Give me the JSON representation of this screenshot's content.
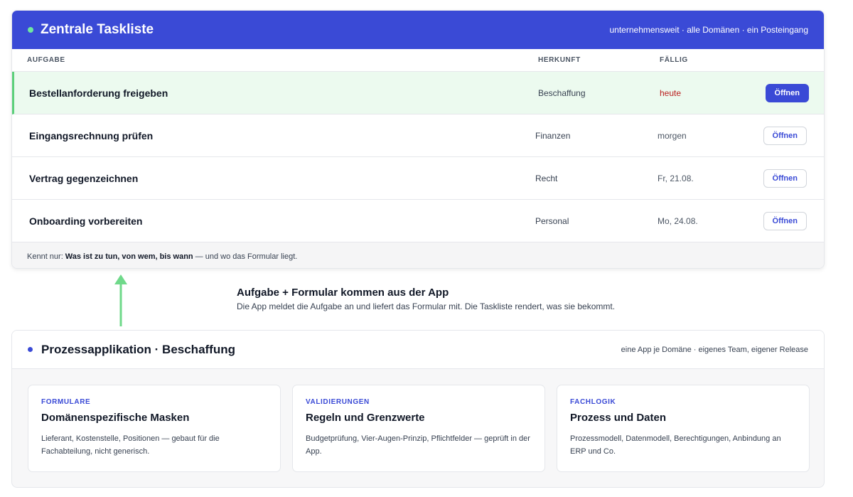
{
  "tasklist": {
    "title": "Zentrale Taskliste",
    "scope": "unternehmensweit · alle Domänen · ein Posteingang",
    "columns": {
      "task": "AUFGABE",
      "origin": "HERKUNFT",
      "due": "FÄLLIG"
    },
    "rows": [
      {
        "name": "Bestellanforderung freigeben",
        "origin": "Beschaffung",
        "due": "heute",
        "action": "Öffnen",
        "active": true
      },
      {
        "name": "Eingangsrechnung prüfen",
        "origin": "Finanzen",
        "due": "morgen",
        "action": "Öffnen",
        "active": false
      },
      {
        "name": "Vertrag gegenzeichnen",
        "origin": "Recht",
        "due": "Fr, 21.08.",
        "action": "Öffnen",
        "active": false
      },
      {
        "name": "Onboarding vorbereiten",
        "origin": "Personal",
        "due": "Mo, 24.08.",
        "action": "Öffnen",
        "active": false
      }
    ],
    "footer": {
      "prefix": "Kennt nur:",
      "emphasis": "Was ist zu tun, von wem, bis wann",
      "suffix": "— und wo das Formular liegt."
    }
  },
  "connector": {
    "title": "Aufgabe + Formular kommen aus der App",
    "text": "Die App meldet die Aufgabe an und liefert das Formular mit. Die Taskliste rendert, was sie bekommt.",
    "arrow_color": "#6fd98a"
  },
  "app": {
    "title": "Prozessapplikation · Beschaffung",
    "scope": "eine App je Domäne · eigenes Team, eigener Release",
    "features": [
      {
        "kicker": "FORMULARE",
        "title": "Domänenspezifische Masken",
        "text": "Lieferant, Kostenstelle, Positionen — gebaut für die Fachabteilung, nicht generisch."
      },
      {
        "kicker": "VALIDIERUNGEN",
        "title": "Regeln und Grenzwerte",
        "text": "Budgetprüfung, Vier-Augen-Prinzip, Pflichtfelder — geprüft in der App."
      },
      {
        "kicker": "FACHLOGIK",
        "title": "Prozess und Daten",
        "text": "Prozessmodell, Datenmodell, Berechtigungen, Anbindung an ERP und Co."
      }
    ]
  },
  "colors": {
    "brand": "#3a4ad6",
    "active_row": "#ecfaef",
    "active_accent": "#5ccf7a",
    "urgent": "#b91c1c"
  }
}
